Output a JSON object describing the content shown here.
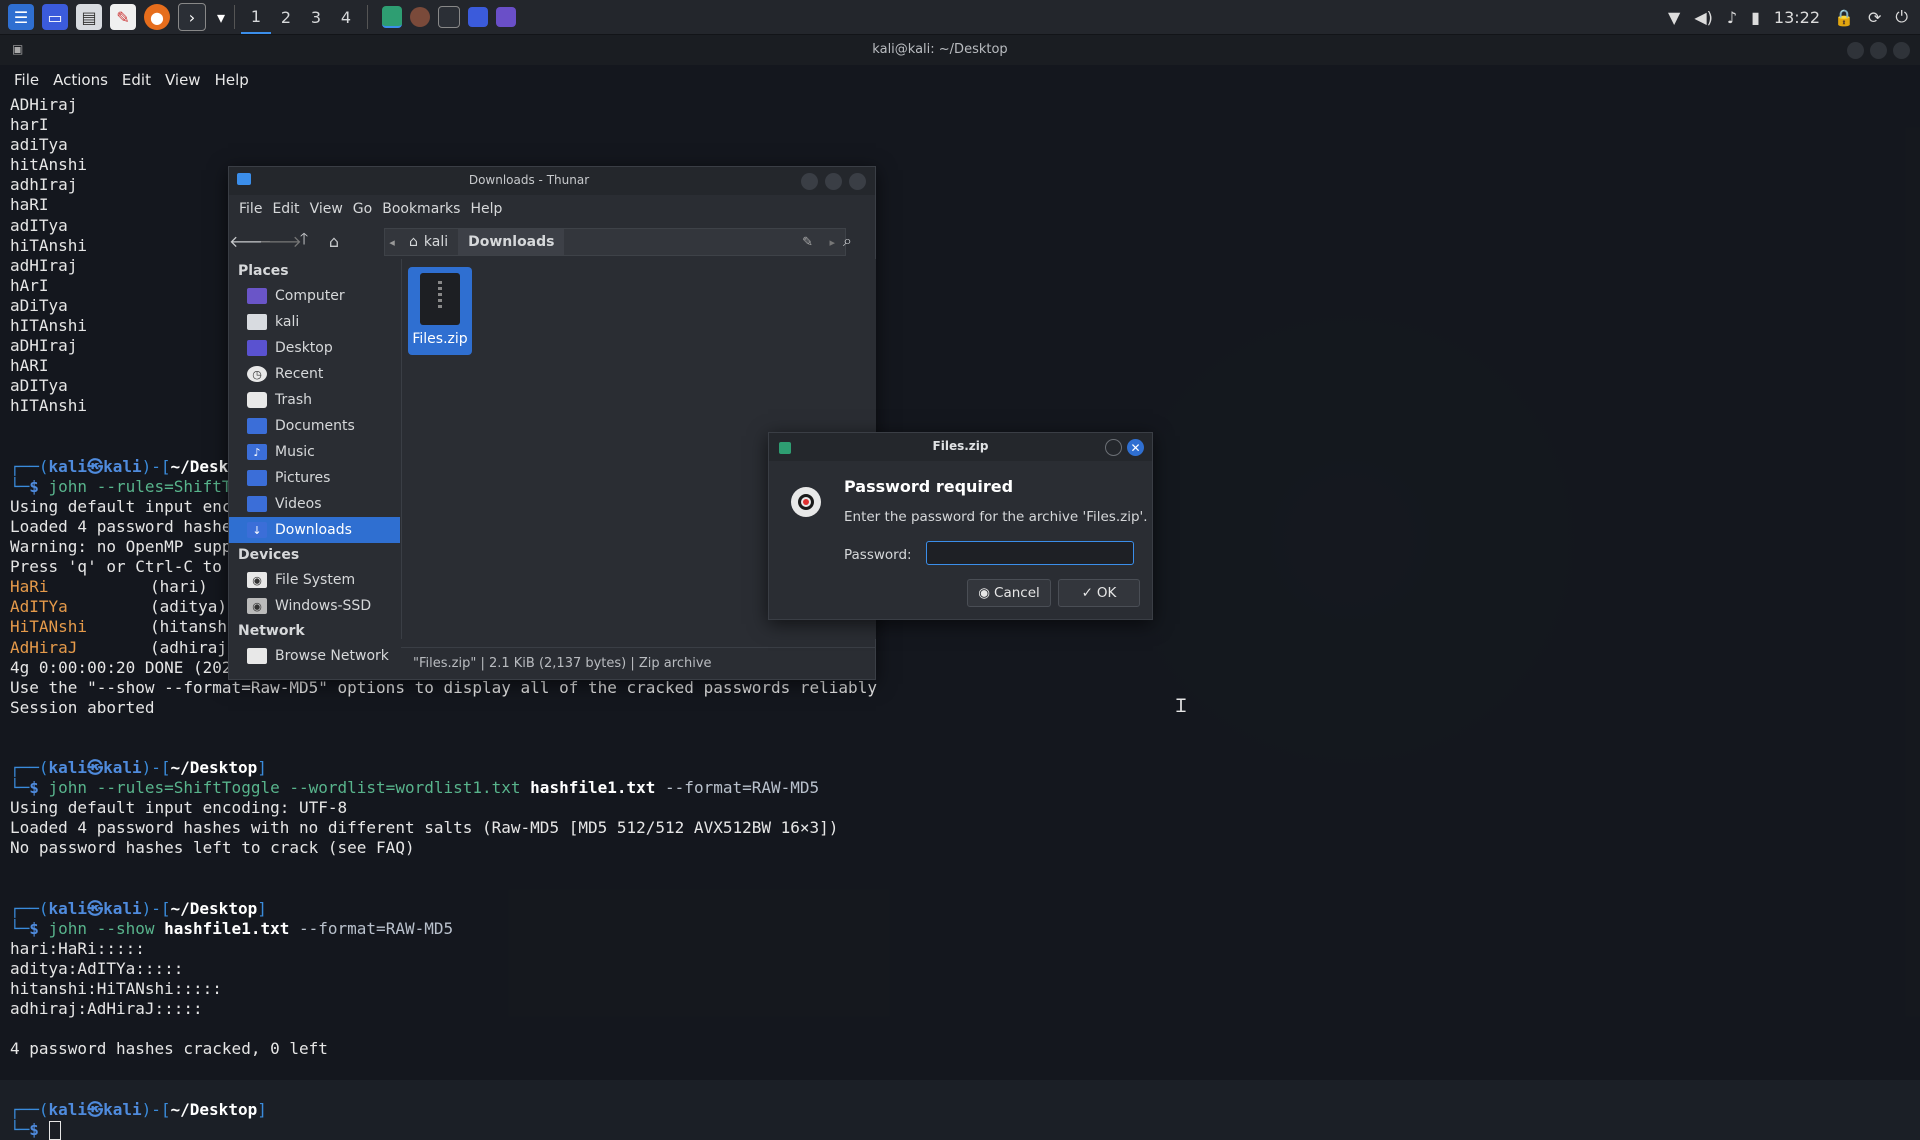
{
  "taskbar": {
    "workspaces": [
      "1",
      "2",
      "3",
      "4"
    ],
    "clock": "13:22"
  },
  "terminal": {
    "title": "kali@kali: ~/Desktop",
    "menu": [
      "File",
      "Actions",
      "Edit",
      "View",
      "Help"
    ],
    "lines": [
      "ADHiraj",
      "harI",
      "adiTya",
      "hitAnshi",
      "adhIraj",
      "haRI",
      "adITya",
      "hiTAnshi",
      "adHIraj",
      "hArI",
      "aDiTya",
      "hITAnshi",
      "aDHIraj",
      "hARI",
      "aDITya",
      "hITAnshi"
    ],
    "prompt_user": "kali",
    "prompt_host": "kali",
    "prompt_dir": "~/Desktop",
    "block1": {
      "cmd": "john --rules=ShiftToggle --wordlist=wordlist1.txt hashfile1.txt --format=RAW-MD5",
      "out": [
        "Using default input encoding: UTF-8",
        "Loaded 4 password hashes with no different salts (Raw-MD5 [MD5 512/512 AVX512BW 16x3])",
        "Warning: no OpenMP support for this hash type, consider --fork=4",
        "Press 'q' or Ctrl-C to abort, almost any other key for status"
      ],
      "cracked": [
        [
          "HaRi",
          "(hari)"
        ],
        [
          "AdITYa",
          "(aditya)"
        ],
        [
          "HiTANshi",
          "(hitanshi)"
        ],
        [
          "AdHiraJ",
          "(adhiraj)"
        ]
      ],
      "tail": [
        "4g 0:00:00:20 DONE (2024-...) 0.1937g/s  ...  HITANSHI",
        "Use the \"--show --format=Raw-MD5\" options to display all of the cracked passwords reliably",
        "Session aborted"
      ]
    },
    "block2": {
      "cmd_prefix": "john --rules=ShiftToggle --wordlist=wordlist1.txt ",
      "cmd_bold": "hashfile1.txt",
      "cmd_suffix": " --format=RAW-MD5",
      "out": [
        "Using default input encoding: UTF-8",
        "Loaded 4 password hashes with no different salts (Raw-MD5 [MD5 512/512 AVX512BW 16×3])",
        "No password hashes left to crack (see FAQ)"
      ]
    },
    "block3": {
      "cmd_prefix": "john --show ",
      "cmd_bold": "hashfile1.txt",
      "cmd_suffix": " --format=RAW-MD5",
      "out": [
        "hari:HaRi:::::",
        "aditya:AdITYa:::::",
        "hitanshi:HiTANshi:::::",
        "adhiraj:AdHiraJ:::::",
        "",
        "4 password hashes cracked, 0 left"
      ]
    }
  },
  "thunar": {
    "title": "Downloads - Thunar",
    "menu": [
      "File",
      "Edit",
      "View",
      "Go",
      "Bookmarks",
      "Help"
    ],
    "path": [
      "kali",
      "Downloads"
    ],
    "places_head": "Places",
    "places": [
      "Computer",
      "kali",
      "Desktop",
      "Recent",
      "Trash",
      "Documents",
      "Music",
      "Pictures",
      "Videos",
      "Downloads"
    ],
    "devices_head": "Devices",
    "devices": [
      "File System",
      "Windows-SSD"
    ],
    "network_head": "Network",
    "network": [
      "Browse Network"
    ],
    "file": "Files.zip",
    "status": "\"Files.zip\"  |  2.1 KiB (2,137 bytes)  |  Zip archive"
  },
  "dialog": {
    "title": "Files.zip",
    "heading": "Password required",
    "message": "Enter the password for the archive 'Files.zip'.",
    "password_label": "Password:",
    "password_value": "",
    "cancel": "Cancel",
    "ok": "OK"
  }
}
